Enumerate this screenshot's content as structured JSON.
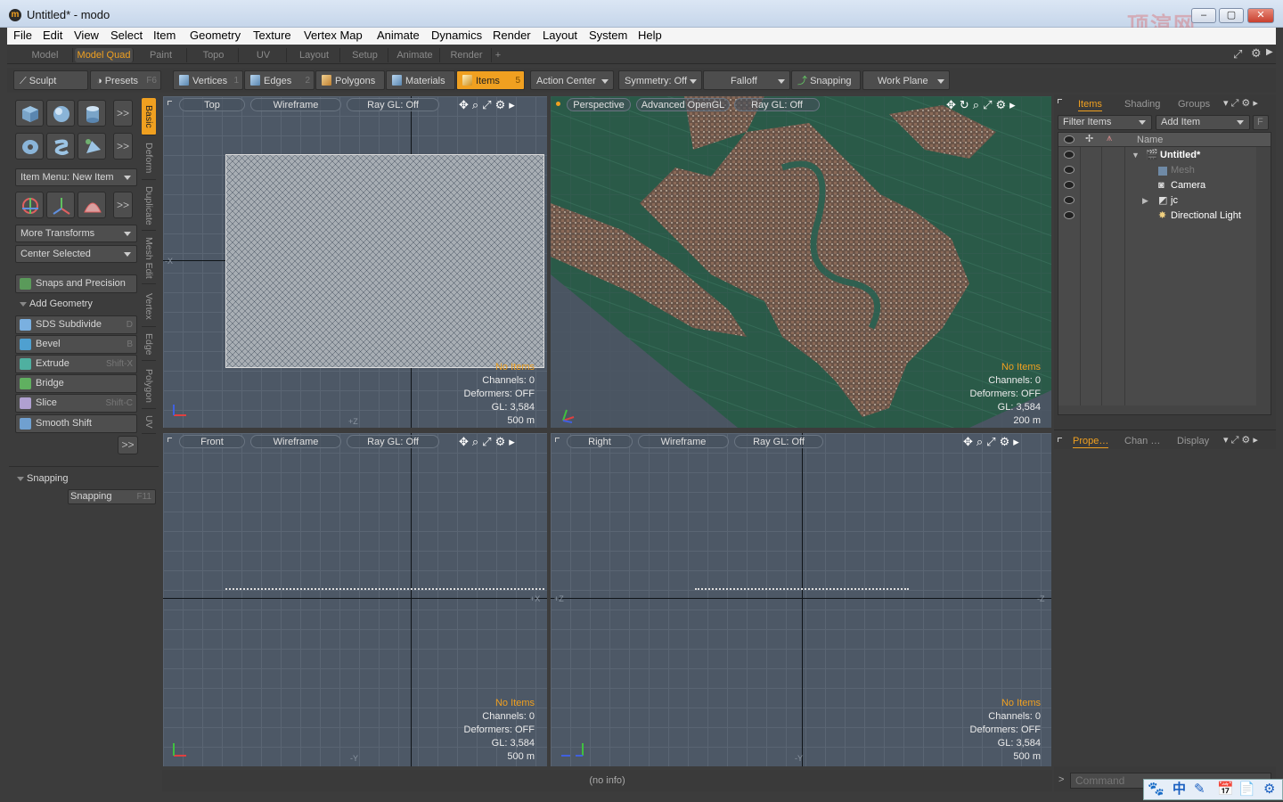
{
  "window": {
    "title": "Untitled* - modo",
    "app_icon": "modo-icon",
    "min": "‒",
    "max": "▢",
    "close": "✕",
    "watermark": "顶渲网"
  },
  "menu": [
    "File",
    "Edit",
    "View",
    "Select",
    "Item",
    "Geometry",
    "Texture",
    "Vertex Map",
    "Animate",
    "Dynamics",
    "Render",
    "Layout",
    "System",
    "Help"
  ],
  "layout_tabs": [
    "Model",
    "Model Quad",
    "Paint",
    "Topo",
    "UV",
    "Layout",
    "Setup",
    "Animate",
    "Render",
    "+"
  ],
  "layout_active": "Model Quad",
  "toolbar": {
    "sculpt": "Sculpt",
    "presets": "Presets",
    "presets_key": "F6",
    "vertices": "Vertices",
    "vertices_key": "1",
    "edges": "Edges",
    "edges_key": "2",
    "polygons": "Polygons",
    "materials": "Materials",
    "items": "Items",
    "items_key": "5",
    "action_center": "Action Center",
    "symmetry": "Symmetry: Off",
    "falloff": "Falloff",
    "snapping": "Snapping",
    "work_plane": "Work Plane"
  },
  "left": {
    "more": ">>",
    "item_menu": "Item Menu: New Item",
    "more_transforms": "More Transforms",
    "center_selected": "Center Selected",
    "snaps_precision": "Snaps and Precision",
    "add_geometry": "Add Geometry",
    "tools": [
      {
        "label": "SDS Subdivide",
        "key": "D",
        "color": "#7ab0e0"
      },
      {
        "label": "Bevel",
        "key": "B",
        "color": "#4fa0d0"
      },
      {
        "label": "Extrude",
        "key": "Shift-X",
        "color": "#4fb0a0"
      },
      {
        "label": "Bridge",
        "key": "",
        "color": "#60b060"
      },
      {
        "label": "Slice",
        "key": "Shift-C",
        "color": "#b0a0d0"
      },
      {
        "label": "Smooth Shift",
        "key": "",
        "color": "#70a0d0"
      }
    ],
    "more_bottom": ">>",
    "snapping_section": "Snapping",
    "snapping_btn": "Snapping",
    "snapping_key": "F11"
  },
  "vtabs": [
    "Basic",
    "Deform",
    "Duplicate",
    "Mesh Edit",
    "Vertex",
    "Edge",
    "Polygon",
    "UV"
  ],
  "viewports": {
    "top": {
      "view": "Top",
      "shading": "Wireframe",
      "ray": "Ray GL: Off",
      "no_items": "No Items",
      "channels": "Channels: 0",
      "deformers": "Deformers: OFF",
      "gl": "GL: 3,584",
      "scale": "500 m",
      "ax_left": "-X",
      "ax_bottom": "+Z"
    },
    "persp": {
      "view": "Perspective",
      "shading": "Advanced OpenGL",
      "ray": "Ray GL: Off",
      "no_items": "No Items",
      "channels": "Channels: 0",
      "deformers": "Deformers: OFF",
      "gl": "GL: 3,584",
      "scale": "200 m"
    },
    "front": {
      "view": "Front",
      "shading": "Wireframe",
      "ray": "Ray GL: Off",
      "no_items": "No Items",
      "channels": "Channels: 0",
      "deformers": "Deformers: OFF",
      "gl": "GL: 3,584",
      "scale": "500 m",
      "ax_right": "+X",
      "ax_bottom": "-Y"
    },
    "right": {
      "view": "Right",
      "shading": "Wireframe",
      "ray": "Ray GL: Off",
      "no_items": "No Items",
      "channels": "Channels: 0",
      "deformers": "Deformers: OFF",
      "gl": "GL: 3,584",
      "scale": "500 m",
      "ax_left": "+Z",
      "ax_right": "-Z",
      "ax_bottom": "-Y"
    }
  },
  "items_panel": {
    "tabs": [
      "Items",
      "Shading",
      "Groups"
    ],
    "filter": "Filter Items",
    "add_item": "Add Item",
    "f_btn": "F",
    "col_name": "Name",
    "rows": [
      {
        "label": "Untitled*",
        "bold": true,
        "indent": 0
      },
      {
        "label": "Mesh",
        "dim": true,
        "indent": 1
      },
      {
        "label": "Camera",
        "indent": 1
      },
      {
        "label": "jc",
        "indent": 1
      },
      {
        "label": "Directional Light",
        "indent": 1
      }
    ]
  },
  "props_panel": {
    "tabs": [
      "Prope…",
      "Chan …",
      "Display"
    ]
  },
  "status": {
    "info": "(no info)",
    "prompt": ">",
    "command_placeholder": "Command"
  },
  "ime": {
    "items": [
      "🐾",
      "中",
      "✎",
      "📅",
      "📄",
      "⚙"
    ]
  }
}
